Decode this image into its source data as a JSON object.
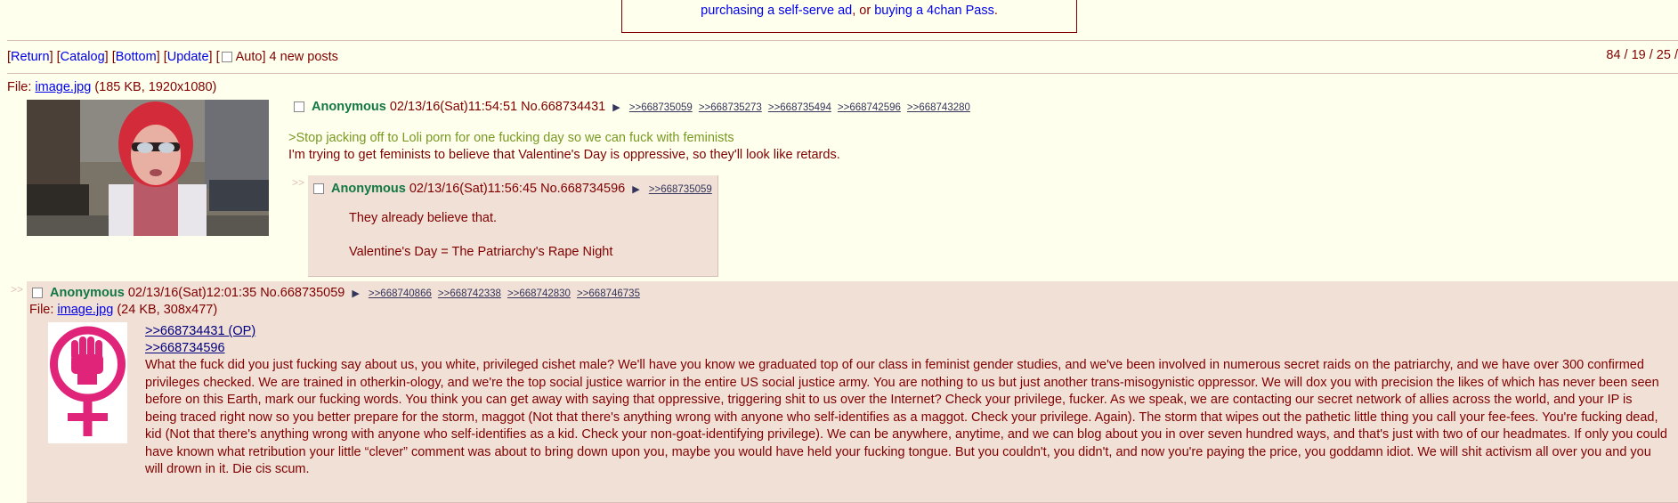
{
  "ad": {
    "line1": "",
    "link1": "purchasing a self-serve ad",
    "or_text": ", or ",
    "link2": "buying a 4chan Pass",
    "period": "."
  },
  "nav": {
    "return": "Return",
    "catalog": "Catalog",
    "bottom": "Bottom",
    "update": "Update",
    "auto": "Auto",
    "new_posts": "4 new posts"
  },
  "pager": "84 / 19 / 25 /",
  "op": {
    "file_label": "File: ",
    "file_name": "image.jpg",
    "file_meta": "(185 KB, 1920x1080)",
    "name": "Anonymous",
    "datetime": "02/13/16(Sat)11:54:51",
    "number": "No.668734431",
    "replies": [
      ">>668735059",
      ">>668735273",
      ">>668735494",
      ">>668742596",
      ">>668743280"
    ],
    "greentext": ">Stop jacking off to Loli porn for one fucking day so we can fuck with feminists",
    "body": "I'm trying to get feminists to believe that Valentine's Day is oppressive, so they'll look like retards."
  },
  "reply1": {
    "arrows": ">>",
    "name": "Anonymous",
    "datetime": "02/13/16(Sat)11:56:45",
    "number": "No.668734596",
    "replies": [
      ">>668735059"
    ],
    "line1": "They already believe that.",
    "line2": "Valentine's Day = The Patriarchy's Rape Night"
  },
  "reply2": {
    "arrows": ">>",
    "name": "Anonymous",
    "datetime": "02/13/16(Sat)12:01:35",
    "number": "No.668735059",
    "replies": [
      ">>668740866",
      ">>668742338",
      ">>668742830",
      ">>668746735"
    ],
    "file_label": "File: ",
    "file_name": "image.jpg",
    "file_meta": "(24 KB, 308x477)",
    "quote1": ">>668734431 (OP)",
    "quote2": ">>668734596",
    "body": "What the fuck did you just fucking say about us, you white, privileged cishet male? We'll have you know we graduated top of our class in feminist gender studies, and we've been involved in numerous secret raids on the patriarchy, and we have over 300 confirmed privileges checked. We are trained in otherkin-ology, and we're the top social justice warrior in the entire US social justice army. You are nothing to us but just another trans-misogynistic oppressor. We will dox you with precision the likes of which has never been seen before on this Earth, mark our fucking words. You think you can get away with saying that oppressive, triggering shit to us over the Internet? Check your privilege, fucker. As we speak, we are contacting our secret network of allies across the world, and your IP is being traced right now so you better prepare for the storm, maggot (Not that there's anything wrong with anyone who self-identifies as a maggot. Check your privilege. Again). The storm that wipes out the pathetic little thing you call your fee-fees. You're fucking dead, kid (Not that there's anything wrong with anyone who self-identifies as a kid. Check your non-goat-identifying privilege). We can be anywhere, anytime, and we can blog about you in over seven hundred ways, and that's just with two of our headmates. If only you could have known what retribution your little “clever” comment was about to bring down upon you, maybe you would have held your fucking tongue. But you couldn't, you didn't, and now you're paying the price, you goddamn idiot. We will shit activism all over you and you will drown in it. Die cis scum."
  },
  "colors": {
    "background": "#ffffee",
    "text": "#800000",
    "name": "#117743",
    "greentext": "#789922",
    "reply_bg": "#f0e0d6",
    "link": "#0000ee",
    "feminist_symbol": "#e0247a"
  }
}
